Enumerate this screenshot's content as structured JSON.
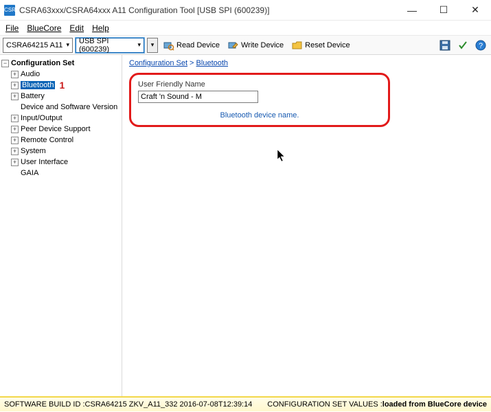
{
  "window": {
    "title": "CSRA63xxx/CSRA64xxx A11 Configuration Tool [USB SPI (600239)]",
    "app_icon_text": "CSR"
  },
  "menu": {
    "file": "File",
    "bluecore": "BlueCore",
    "edit": "Edit",
    "help": "Help"
  },
  "toolbar": {
    "combo1": "CSRA64215 A11",
    "combo2": "USB SPI (600239)",
    "read": "Read Device",
    "write": "Write Device",
    "reset": "Reset Device"
  },
  "tree": {
    "root": "Configuration Set",
    "items": [
      {
        "label": "Audio",
        "exp": "+"
      },
      {
        "label": "Bluetooth",
        "exp": "+",
        "selected": true,
        "annot": "1"
      },
      {
        "label": "Battery",
        "exp": "+"
      },
      {
        "label": "Device and Software Version",
        "exp": ""
      },
      {
        "label": "Input/Output",
        "exp": "+"
      },
      {
        "label": "Peer Device Support",
        "exp": "+"
      },
      {
        "label": "Remote Control",
        "exp": "+"
      },
      {
        "label": "System",
        "exp": "+"
      },
      {
        "label": "User Interface",
        "exp": "+"
      },
      {
        "label": "GAIA",
        "exp": ""
      }
    ]
  },
  "breadcrumb": {
    "a": "Configuration Set",
    "sep": " > ",
    "b": "Bluetooth"
  },
  "panel": {
    "label": "User Friendly Name",
    "value": "Craft 'n Sound - M",
    "hint": "Bluetooth device name."
  },
  "status": {
    "k1": "SOFTWARE BUILD ID :  ",
    "v1": "CSRA64215 ZKV_A11_332 2016-07-08T12:39:14",
    "k2": "CONFIGURATION SET VALUES :  ",
    "v2": "loaded from BlueCore device"
  }
}
